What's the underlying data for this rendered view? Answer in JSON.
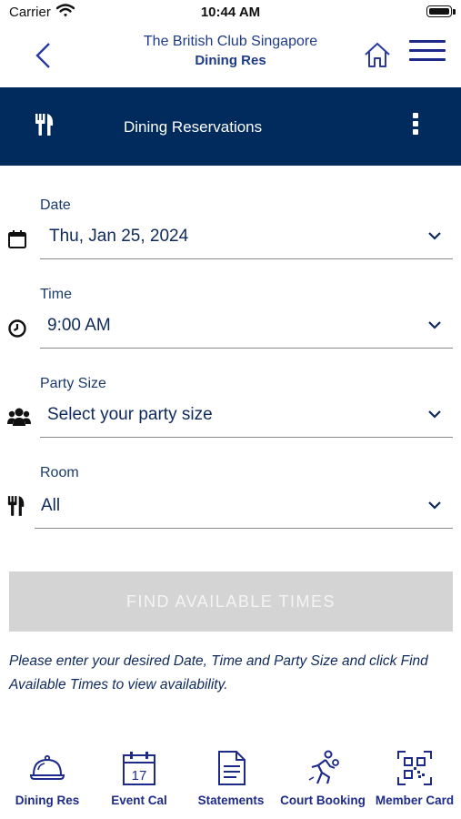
{
  "status_bar": {
    "carrier": "Carrier",
    "time": "10:44 AM"
  },
  "header": {
    "title": "The British Club Singapore",
    "subtitle": "Dining Res"
  },
  "title_bar": {
    "title": "Dining Reservations"
  },
  "form": {
    "date": {
      "label": "Date",
      "value": "Thu, Jan 25, 2024"
    },
    "time": {
      "label": "Time",
      "value": "9:00 AM"
    },
    "party_size": {
      "label": "Party Size",
      "value": "Select your party size"
    },
    "room": {
      "label": "Room",
      "value": "All"
    }
  },
  "find_button": {
    "label": "FIND AVAILABLE TIMES"
  },
  "hint": "Please enter your desired Date, Time and Party Size and click Find Available Times to view availability.",
  "tabs": [
    {
      "label": "Dining Res",
      "icon": "cloche-icon"
    },
    {
      "label": "Event Cal",
      "icon": "calendar-icon",
      "day": "17"
    },
    {
      "label": "Statements",
      "icon": "document-icon"
    },
    {
      "label": "Court Booking",
      "icon": "runner-icon"
    },
    {
      "label": "Member Card",
      "icon": "qr-code-icon"
    }
  ],
  "colors": {
    "primary": "#002b5c",
    "accent": "#1e2a8a",
    "disabled": "#d4d4d4"
  }
}
